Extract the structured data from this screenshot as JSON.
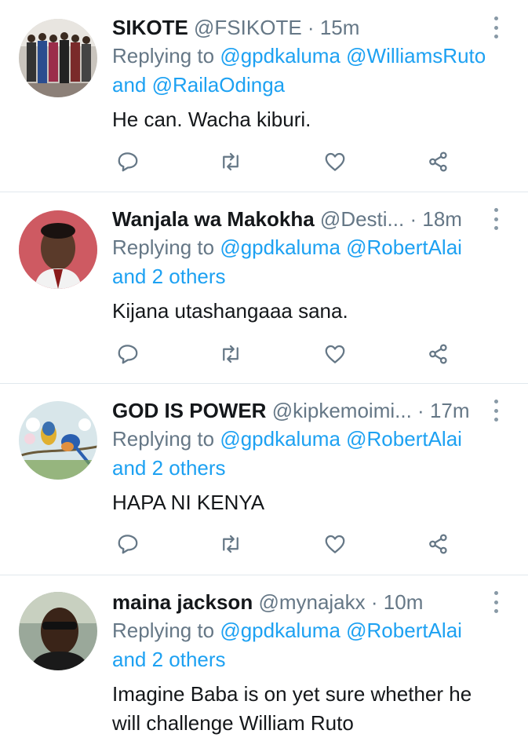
{
  "replying_label": "Replying to",
  "tweets": [
    {
      "name": "SIKOTE",
      "handle": "@FSIKOTE",
      "time": "15m",
      "reply_mentions": [
        "@gpdkaluma",
        "@WilliamsRuto",
        "and",
        "@RailaOdinga"
      ],
      "text": "He can. Wacha kiburi."
    },
    {
      "name": "Wanjala wa Makokha",
      "handle": "@Desti...",
      "time": "18m",
      "reply_mentions": [
        "@gpdkaluma",
        "@RobertAlai",
        "and 2 others"
      ],
      "text": "Kijana utashangaaa sana."
    },
    {
      "name": "GOD IS POWER",
      "handle": "@kipkemoimi...",
      "time": "17m",
      "reply_mentions": [
        "@gpdkaluma",
        "@RobertAlai",
        "and 2 others"
      ],
      "text": "HAPA NI KENYA"
    },
    {
      "name": "maina jackson",
      "handle": "@mynajakx",
      "time": "10m",
      "reply_mentions": [
        "@gpdkaluma",
        "@RobertAlai",
        "and 2 others"
      ],
      "text": "Imagine Baba is on yet sure whether he will challenge William Ruto"
    }
  ],
  "icons": {
    "reply": "reply-icon",
    "retweet": "retweet-icon",
    "like": "heart-icon",
    "share": "share-icon",
    "more": "more-vertical-icon"
  },
  "colors": {
    "link": "#1da1f2",
    "secondary": "#657786",
    "text": "#14171a",
    "divider": "#e1e8ed"
  }
}
